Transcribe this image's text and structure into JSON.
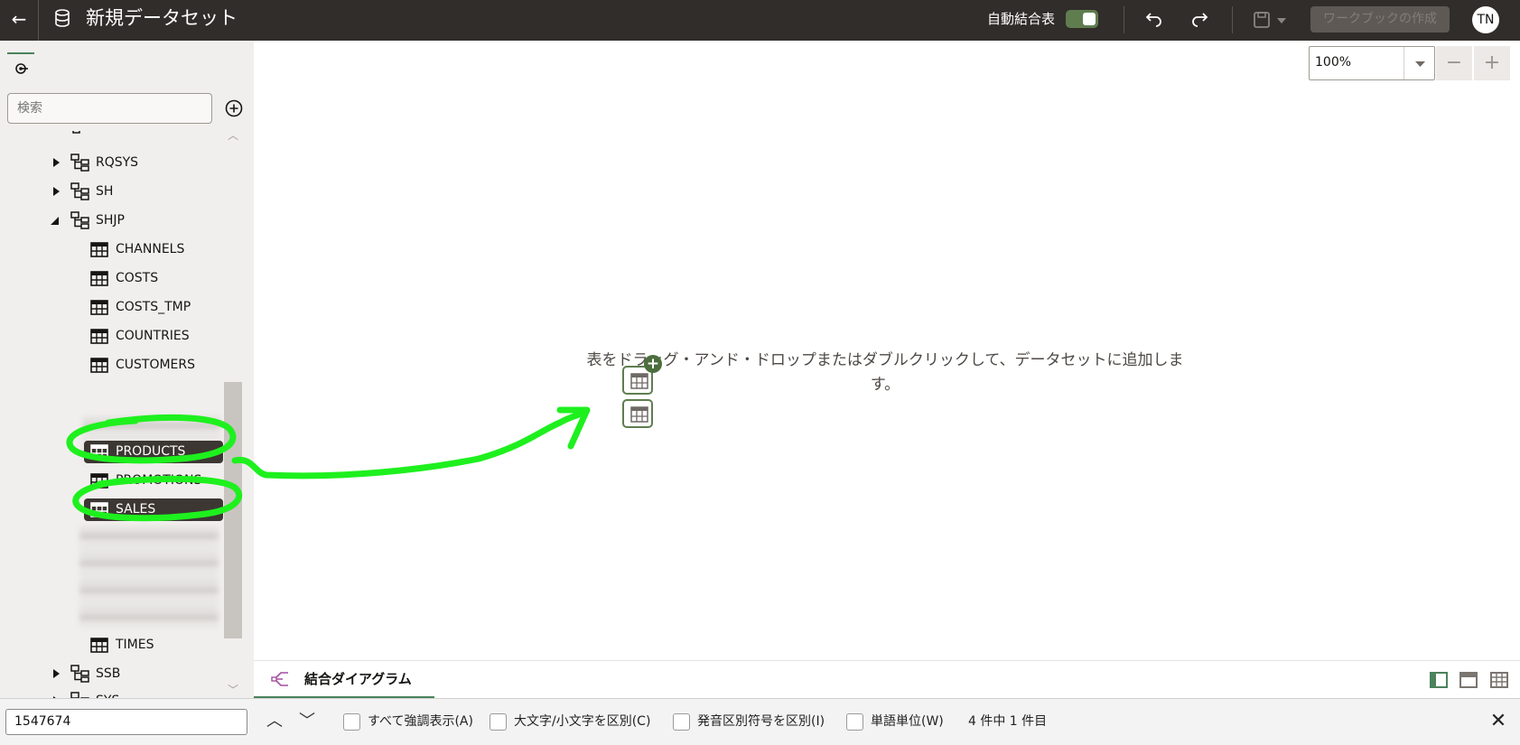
{
  "topbar": {
    "title": "新規データセット",
    "autojoin_label": "自動結合表",
    "autojoin_on": true,
    "create_workbook_label": "ワークブックの作成",
    "user_initials": "TN"
  },
  "sidebar": {
    "search_placeholder": "検索",
    "schemas": [
      {
        "name": "RQSYS",
        "expanded": false
      },
      {
        "name": "SH",
        "expanded": false
      },
      {
        "name": "SHJP",
        "expanded": true
      },
      {
        "name": "SSB",
        "expanded": false
      },
      {
        "name": "SYS",
        "expanded": false
      }
    ],
    "tables": [
      {
        "name": "CHANNELS",
        "selected": false
      },
      {
        "name": "COSTS",
        "selected": false
      },
      {
        "name": "COSTS_TMP",
        "selected": false
      },
      {
        "name": "COUNTRIES",
        "selected": false
      },
      {
        "name": "CUSTOMERS",
        "selected": false
      },
      {
        "name": "PRODUCTS",
        "selected": true
      },
      {
        "name": "PROMOTIONS",
        "selected": false
      },
      {
        "name": "SALES",
        "selected": true
      },
      {
        "name": "TIMES",
        "selected": false
      }
    ]
  },
  "canvas": {
    "zoom_value": "100%",
    "hint_line1": "表をドラッグ・アンド・ドロップまたはダブルクリックして、データセットに追加しま",
    "hint_line2": "す。"
  },
  "bottom_tabs": {
    "active_label": "結合ダイアグラム"
  },
  "findbar": {
    "query": "1547674",
    "highlight_all": "すべて強調表示(A)",
    "match_case": "大文字/小文字を区別(C)",
    "match_diacritics": "発音区別符号を区別(I)",
    "whole_words": "単語単位(W)",
    "result_count": "4 件中 1 件目"
  },
  "colors": {
    "topbar": "#312d2a",
    "accent_green": "#5f7d4f",
    "annotation_green": "#1ef01e",
    "selected_item": "#3c3732"
  }
}
